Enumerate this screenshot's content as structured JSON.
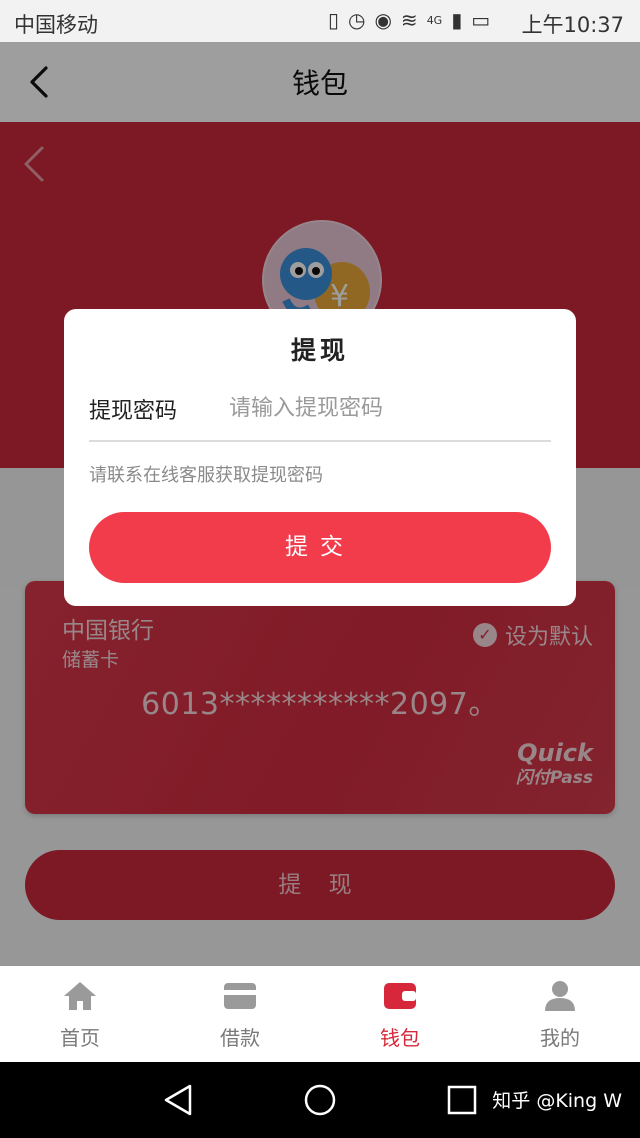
{
  "status_bar": {
    "carrier": "中国移动",
    "time": "上午10:37",
    "network": "4G"
  },
  "header": {
    "title": "钱包"
  },
  "card": {
    "bank": "中国银行",
    "type": "储蓄卡",
    "default_label": "设为默认",
    "number": "6013***********2097。",
    "brand_line1": "Quick",
    "brand_line2": "闪付Pass"
  },
  "withdraw_button": "提 现",
  "dialog": {
    "title": "提现",
    "field_label": "提现密码",
    "field_placeholder": "请输入提现密码",
    "field_value": "",
    "hint": "请联系在线客服获取提现密码",
    "submit_label": "提交"
  },
  "tabs": [
    {
      "label": "首页",
      "icon": "home-icon",
      "active": false
    },
    {
      "label": "借款",
      "icon": "card-icon",
      "active": false
    },
    {
      "label": "钱包",
      "icon": "wallet-icon",
      "active": true
    },
    {
      "label": "我的",
      "icon": "user-icon",
      "active": false
    }
  ],
  "watermark": "知乎 @King W",
  "colors": {
    "brand_red": "#c8293a",
    "dialog_button": "#f23b4b",
    "active_tab": "#d6283a"
  }
}
